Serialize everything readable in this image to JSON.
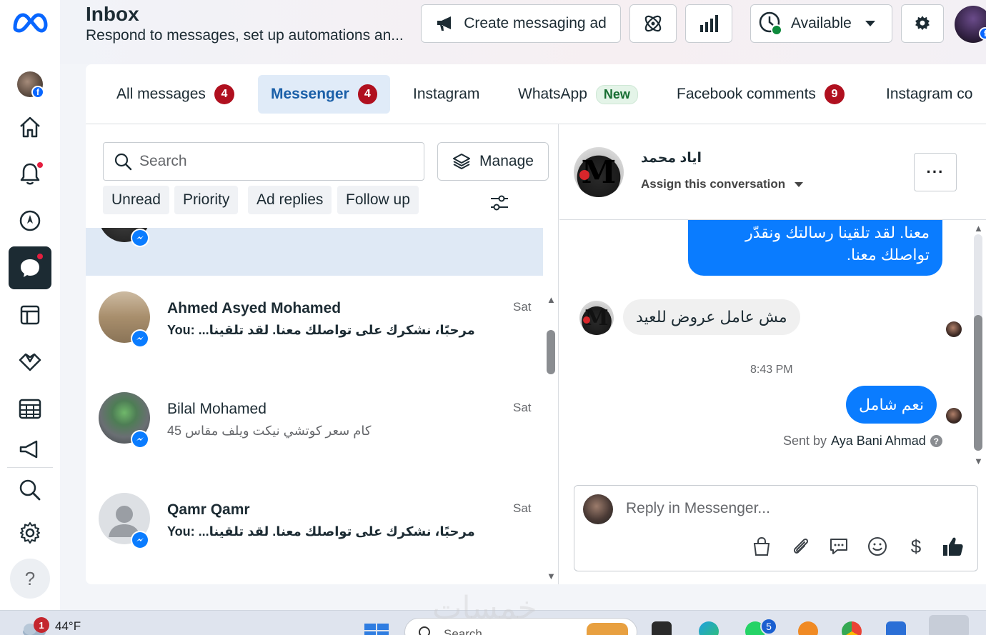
{
  "header": {
    "title": "Inbox",
    "subtitle": "Respond to messages, set up automations an...",
    "create_ad_label": "Create messaging ad",
    "availability_label": "Available"
  },
  "tabs": [
    {
      "label": "All messages",
      "count": "4"
    },
    {
      "label": "Messenger",
      "count": "4"
    },
    {
      "label": "Instagram"
    },
    {
      "label": "WhatsApp",
      "badge": "New"
    },
    {
      "label": "Facebook comments",
      "count": "9"
    },
    {
      "label": "Instagram co"
    }
  ],
  "list": {
    "search_placeholder": "Search",
    "manage_label": "Manage",
    "filters": [
      "Unread",
      "Priority",
      "Ad replies",
      "Follow up"
    ],
    "conversations": [
      {
        "name": "Ahmed Asyed Mohamed",
        "you_prefix": "You:",
        "preview": "مرحبًا، نشكرك على تواصلك معنا. لقد تلقينا...",
        "time": "Sat",
        "unread": true
      },
      {
        "name": "Bilal Mohamed",
        "you_prefix": "",
        "preview": "كام سعر كوتشي نيكت ويلف مقاس 45",
        "time": "Sat",
        "unread": false
      },
      {
        "name": "Qamr Qamr",
        "you_prefix": "You:",
        "preview": "مرحبًا، نشكرك على تواصلك معنا. لقد تلقينا...",
        "time": "Sat",
        "unread": true
      }
    ]
  },
  "thread": {
    "contact_name": "اياد محمد",
    "assign_label": "Assign this conversation",
    "messages": {
      "out_1_line1": "معنا. لقد تلقينا رسالتك ونقدّر",
      "out_1_line2": "تواصلك معنا.",
      "in_1": "مش عامل عروض للعيد",
      "time": "8:43 PM",
      "out_2": "نعم شامل"
    },
    "sent_by_prefix": "Sent by",
    "sent_by_name": "Aya Bani Ahmad",
    "reply_placeholder": "Reply in Messenger..."
  },
  "taskbar": {
    "temperature": "44°F",
    "weather_badge": "1",
    "search_label": "Search",
    "whatsapp_badge": "5"
  },
  "watermark": "خمسات",
  "colors": {
    "accent": "#0a7cff",
    "brand_blue": "#0866ff",
    "badge_red": "#b0101f",
    "sidebar_active": "#1c2b33"
  },
  "icons": [
    "meta-logo",
    "home-icon",
    "bell-icon",
    "compass-icon",
    "inbox-icon",
    "pages-icon",
    "handshake-icon",
    "table-icon",
    "megaphone-icon",
    "search-icon",
    "gear-icon",
    "help-icon"
  ]
}
